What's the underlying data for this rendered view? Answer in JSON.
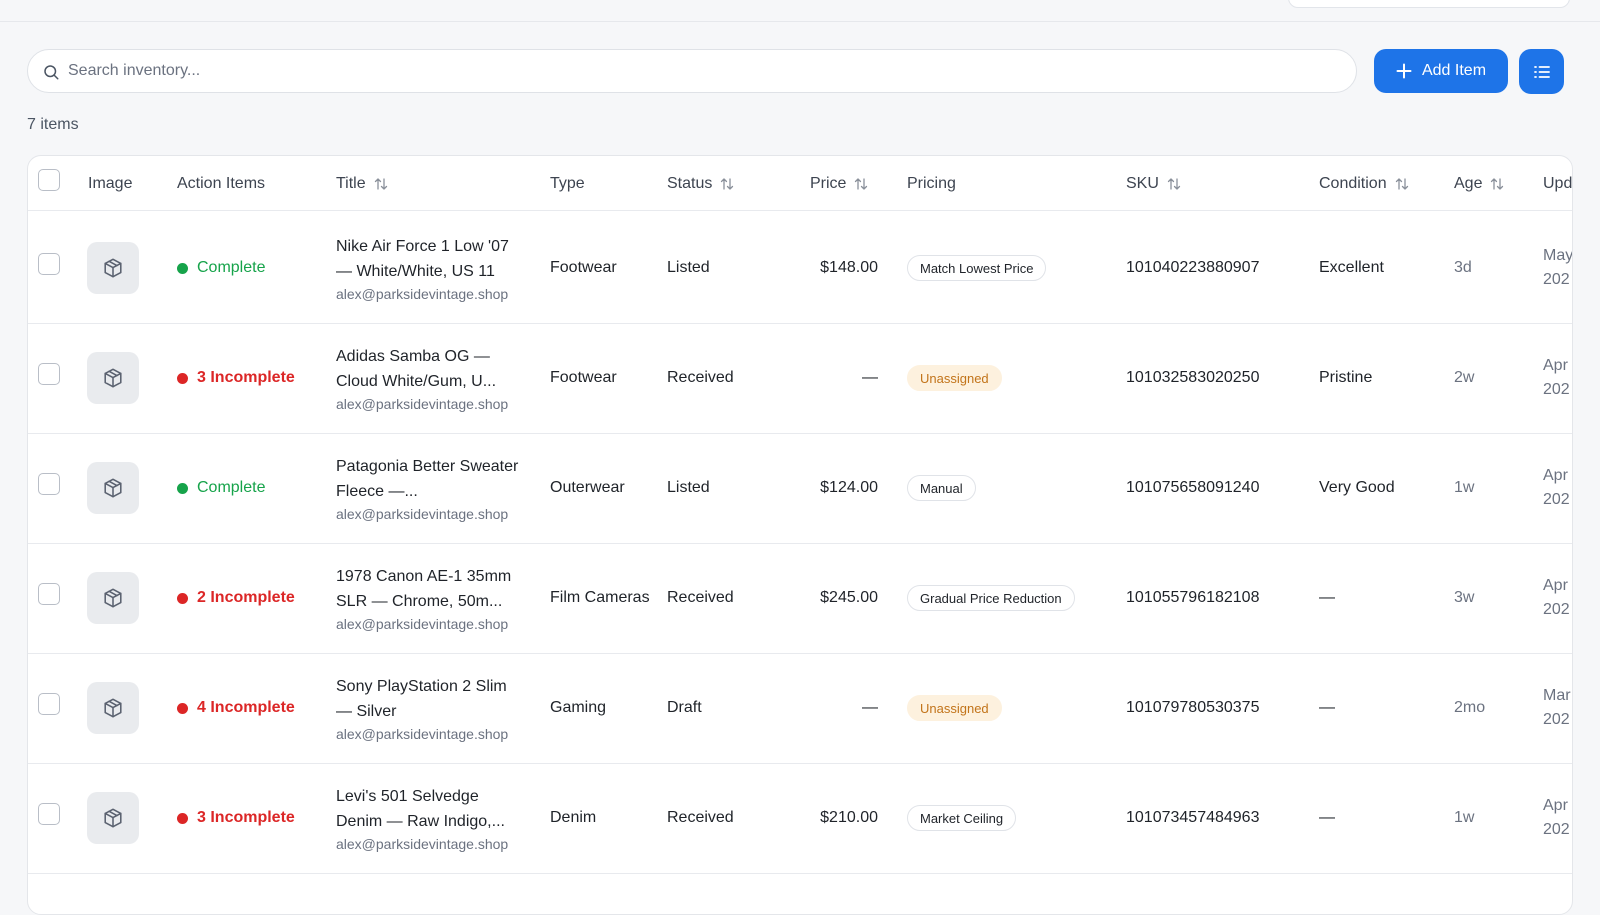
{
  "search": {
    "placeholder": "Search inventory..."
  },
  "toolbar": {
    "add_label": "Add Item"
  },
  "summary": {
    "count_label": "7 items"
  },
  "columns": {
    "image": "Image",
    "action_items": "Action Items",
    "title": "Title",
    "type": "Type",
    "status": "Status",
    "price": "Price",
    "pricing": "Pricing",
    "sku": "SKU",
    "condition": "Condition",
    "age": "Age",
    "updated": "Upd"
  },
  "colors": {
    "accent": "#1e74e8",
    "complete": "#16a34a",
    "incomplete": "#dc2626",
    "unassigned_bg": "#fdf1de",
    "unassigned_text": "#c2741a"
  },
  "rows": [
    {
      "action_status": "complete",
      "action_label": "Complete",
      "title": "Nike Air Force 1 Low '07 — White/White, US 11",
      "seller": "alex@parksidevintage.shop",
      "type": "Footwear",
      "status": "Listed",
      "price": "$148.00",
      "pricing": "Match Lowest Price",
      "pricing_style": "default",
      "sku": "101040223880907",
      "condition": "Excellent",
      "age": "3d",
      "updated_l1": "May",
      "updated_l2": "202"
    },
    {
      "action_status": "incomplete",
      "action_label": "3 Incomplete",
      "title": "Adidas Samba OG — Cloud White/Gum, U...",
      "seller": "alex@parksidevintage.shop",
      "type": "Footwear",
      "status": "Received",
      "price": "—",
      "pricing": "Unassigned",
      "pricing_style": "unassigned",
      "sku": "101032583020250",
      "condition": "Pristine",
      "age": "2w",
      "updated_l1": "Apr",
      "updated_l2": "202"
    },
    {
      "action_status": "complete",
      "action_label": "Complete",
      "title": "Patagonia Better Sweater Fleece —...",
      "seller": "alex@parksidevintage.shop",
      "type": "Outerwear",
      "status": "Listed",
      "price": "$124.00",
      "pricing": "Manual",
      "pricing_style": "default",
      "sku": "101075658091240",
      "condition": "Very Good",
      "age": "1w",
      "updated_l1": "Apr",
      "updated_l2": "202"
    },
    {
      "action_status": "incomplete",
      "action_label": "2 Incomplete",
      "title": "1978 Canon AE-1 35mm SLR — Chrome, 50m...",
      "seller": "alex@parksidevintage.shop",
      "type": "Film Cameras",
      "status": "Received",
      "price": "$245.00",
      "pricing": "Gradual Price Reduction",
      "pricing_style": "default",
      "sku": "101055796182108",
      "condition": "—",
      "age": "3w",
      "updated_l1": "Apr",
      "updated_l2": "202"
    },
    {
      "action_status": "incomplete",
      "action_label": "4 Incomplete",
      "title": "Sony PlayStation 2 Slim — Silver",
      "seller": "alex@parksidevintage.shop",
      "type": "Gaming",
      "status": "Draft",
      "price": "—",
      "pricing": "Unassigned",
      "pricing_style": "unassigned",
      "sku": "101079780530375",
      "condition": "—",
      "age": "2mo",
      "updated_l1": "Mar",
      "updated_l2": "202"
    },
    {
      "action_status": "incomplete",
      "action_label": "3 Incomplete",
      "title": "Levi's 501 Selvedge Denim — Raw Indigo,...",
      "seller": "alex@parksidevintage.shop",
      "type": "Denim",
      "status": "Received",
      "price": "$210.00",
      "pricing": "Market Ceiling",
      "pricing_style": "default",
      "sku": "101073457484963",
      "condition": "—",
      "age": "1w",
      "updated_l1": "Apr",
      "updated_l2": "202"
    }
  ]
}
